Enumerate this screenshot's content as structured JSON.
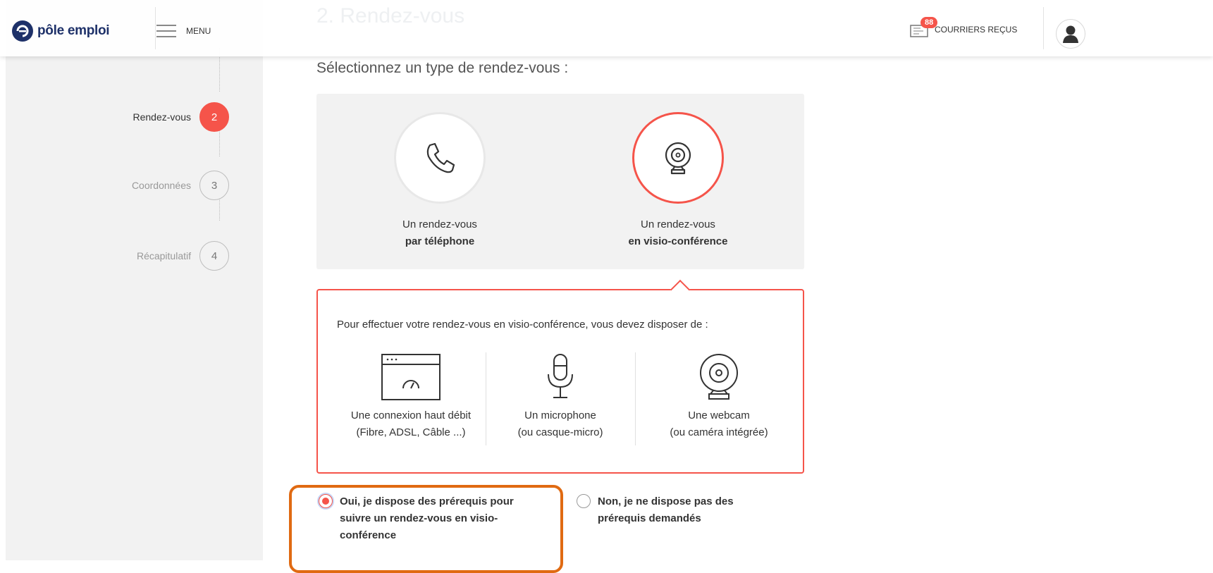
{
  "header": {
    "logo_text": "pôle emploi",
    "menu_label": "MENU",
    "mail_badge": "88",
    "mail_label": "COURRIERS REÇUS",
    "ghost_title": "2. Rendez-vous",
    "accent_color": "#f5544a",
    "brand_color": "#1e3169"
  },
  "steps": [
    {
      "number": "2",
      "label": "Rendez-vous",
      "active": true
    },
    {
      "number": "3",
      "label": "Coordonnées",
      "active": false
    },
    {
      "number": "4",
      "label": "Récapitulatif",
      "active": false
    }
  ],
  "main": {
    "section_title": "Sélectionnez un type de rendez-vous :",
    "choices": [
      {
        "line1": "Un rendez-vous",
        "line2": "par téléphone",
        "icon": "phone-icon",
        "selected": false
      },
      {
        "line1": "Un rendez-vous",
        "line2": "en visio-conférence",
        "icon": "webcam-icon",
        "selected": true
      }
    ],
    "requirements": {
      "intro": "Pour effectuer votre rendez-vous en visio-conférence, vous devez disposer de :",
      "items": [
        {
          "line1": "Une connexion haut débit",
          "line2": "(Fibre, ADSL, Câble ...)",
          "icon": "speedometer-window-icon"
        },
        {
          "line1": "Un microphone",
          "line2": "(ou casque-micro)",
          "icon": "microphone-icon"
        },
        {
          "line1": "Une webcam",
          "line2": "(ou caméra intégrée)",
          "icon": "webcam-icon"
        }
      ]
    },
    "radios": [
      {
        "line1": "Oui, je dispose des prérequis pour",
        "line2": "suivre un rendez-vous en visio-",
        "line3": "conférence",
        "checked": true
      },
      {
        "line1": "Non, je ne dispose pas des",
        "line2": "prérequis demandés",
        "checked": false
      }
    ]
  }
}
